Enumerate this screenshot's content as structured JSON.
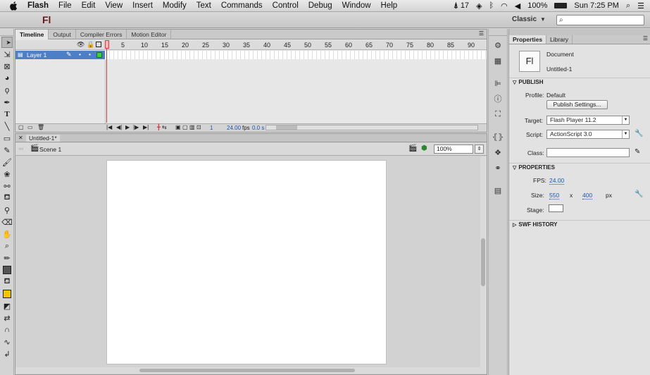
{
  "menubar": {
    "app_name": "Flash",
    "items": [
      "File",
      "Edit",
      "View",
      "Insert",
      "Modify",
      "Text",
      "Commands",
      "Control",
      "Debug",
      "Window",
      "Help"
    ],
    "status": {
      "adobe_count": "17",
      "battery": "100%",
      "clock": "Sun 7:25 PM"
    }
  },
  "appbar": {
    "logo": "Fl",
    "workspace": "Classic"
  },
  "timeline": {
    "tabs": [
      "Timeline",
      "Output",
      "Compiler Errors",
      "Motion Editor"
    ],
    "frame_numbers": [
      "1",
      "5",
      "10",
      "15",
      "20",
      "25",
      "30",
      "35",
      "40",
      "45",
      "50",
      "55",
      "60",
      "65",
      "70",
      "75",
      "80",
      "85",
      "90"
    ],
    "layer_name": "Layer 1",
    "footer": {
      "current_frame": "1",
      "fps": "24.00",
      "fps_unit": "fps",
      "time": "0.0 s"
    }
  },
  "stage": {
    "doc_tab": "Untitled-1*",
    "scene": "Scene 1",
    "zoom": "100%"
  },
  "properties": {
    "tabs": [
      "Properties",
      "Library"
    ],
    "doc_type": "Document",
    "doc_name": "Untitled-1",
    "icon_text": "Fl",
    "publish": {
      "header": "PUBLISH",
      "profile_label": "Profile:",
      "profile_value": "Default",
      "publish_settings_button": "Publish Settings...",
      "target_label": "Target:",
      "target_value": "Flash Player 11.2",
      "script_label": "Script:",
      "script_value": "ActionScript 3.0",
      "class_label": "Class:",
      "class_value": ""
    },
    "properties_section": {
      "header": "PROPERTIES",
      "fps_label": "FPS:",
      "fps_value": "24.00",
      "size_label": "Size:",
      "width": "550",
      "times": "x",
      "height": "400",
      "unit": "px",
      "stage_label": "Stage:",
      "stage_color": "#ffffff"
    },
    "swf_history": {
      "header": "SWF HISTORY"
    }
  },
  "icons": {
    "tools": [
      "selection-icon",
      "subselection-icon",
      "free-transform-icon",
      "3d-rotation-icon",
      "lasso-icon",
      "pen-icon",
      "text-icon",
      "line-icon",
      "rectangle-icon",
      "pencil-icon",
      "brush-icon",
      "deco-icon",
      "bone-icon",
      "paint-bucket-icon",
      "eyedropper-icon",
      "eraser-icon",
      "hand-icon",
      "zoom-icon",
      "stroke-color-icon",
      "fill-color-icon",
      "swap-colors-icon",
      "snap-icon",
      "smooth-icon",
      "straighten-icon"
    ]
  },
  "colors": {
    "layer_highlight": "#4d7fc6",
    "playhead": "#d23c3c",
    "stroke_swatch": "#555555",
    "fill_swatch": "#f5c400"
  }
}
